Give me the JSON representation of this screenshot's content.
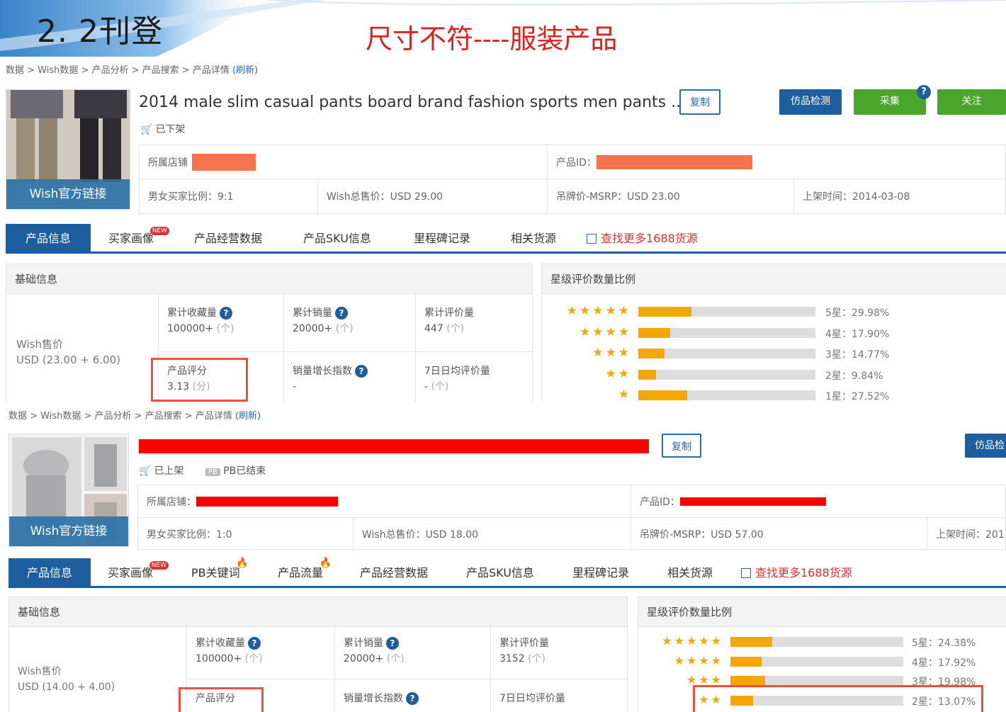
{
  "slide": {
    "number": "2. 2刊登",
    "title": "尺寸不符----服装产品"
  },
  "colors": {
    "accent": "#1d5f9e",
    "green": "#4aa62a",
    "star": "#f5a70a",
    "alert": "#e02020"
  },
  "panel_a": {
    "breadcrumb": "数据 > Wish数据 > 产品分析 > 产品搜索 > 产品详情",
    "refresh": "(刷新)",
    "thumb_link": "Wish官方链接",
    "title": "2014 male slim casual pants board brand fashion sports men pants ...",
    "copy_button": "复制",
    "buttons": {
      "detect": "仿品检测",
      "collect": "采集",
      "follow": "关注",
      "help": "?"
    },
    "status": "已下架",
    "info": {
      "store_label": "所属店铺",
      "product_id_label": "产品ID：",
      "gender_ratio": "男女买家比例：9:1",
      "total_price": "Wish总售价：USD 29.00",
      "msrp": "吊牌价-MSRP：USD 23.00",
      "listed": "上架时间：2014-03-08"
    },
    "tabs": [
      "产品信息",
      "买家画像",
      "产品经营数据",
      "产品SKU信息",
      "里程碑记录",
      "相关货源",
      "查找更多1688货源"
    ],
    "new_badge": "NEW",
    "basic": {
      "header": "基础信息",
      "wish_price_label": "Wish售价",
      "wish_price_value": "USD (23.00 + 6.00)",
      "fav_label": "累计收藏量",
      "fav_value": "100000+",
      "fav_unit": "(个)",
      "sales_label": "累计销量",
      "sales_value": "20000+",
      "sales_unit": "(个)",
      "reviews_label": "累计评价量",
      "reviews_value": "447",
      "reviews_unit": "(个)",
      "score_label": "产品评分",
      "score_value": "3.13",
      "score_unit": "(分)",
      "growth_label": "销量增长指数",
      "growth_value": "-",
      "avg7_label": "7日日均评价量",
      "avg7_value": "-",
      "avg7_unit": "(个)"
    },
    "ratings": {
      "header": "星级评价数量比例",
      "rows": [
        {
          "stars": 5,
          "pct": 29.98,
          "label": "5星：29.98%"
        },
        {
          "stars": 4,
          "pct": 17.9,
          "label": "4星：17.90%"
        },
        {
          "stars": 3,
          "pct": 14.77,
          "label": "3星：14.77%"
        },
        {
          "stars": 2,
          "pct": 9.84,
          "label": "2星：9.84%"
        },
        {
          "stars": 1,
          "pct": 27.52,
          "label": "1星：27.52%"
        }
      ]
    }
  },
  "panel_b": {
    "breadcrumb": "数据 > Wish数据 > 产品分析 > 产品搜索 > 产品详情",
    "refresh": "(刷新)",
    "thumb_link": "Wish官方链接",
    "copy_button": "复制",
    "detect_button": "仿品检",
    "status_listed": "已上架",
    "pb_badge": "PB",
    "status_pb": "PB已结束",
    "info": {
      "store_label": "所属店铺：",
      "product_id_label": "产品ID：",
      "gender_ratio": "男女买家比例：1:0",
      "total_price": "Wish总售价：USD 18.00",
      "msrp": "吊牌价-MSRP：USD 57.00",
      "listed": "上架时间：201"
    },
    "tabs": [
      "产品信息",
      "买家画像",
      "PB关键词",
      "产品流量",
      "产品经营数据",
      "产品SKU信息",
      "里程碑记录",
      "相关货源",
      "查找更多1688货源"
    ],
    "new_badge": "NEW",
    "basic": {
      "header": "基础信息",
      "wish_price_label": "Wish售价",
      "wish_price_value": "USD (14.00 + 4.00)",
      "fav_label": "累计收藏量",
      "fav_value": "100000+",
      "fav_unit": "(个)",
      "sales_label": "累计销量",
      "sales_value": "20000+",
      "sales_unit": "(个)",
      "reviews_label": "累计评价量",
      "reviews_value": "3152",
      "reviews_unit": "(个)",
      "score_label": "产品评分",
      "growth_label": "销量增长指数",
      "avg7_label": "7日日均评价量"
    },
    "ratings": {
      "header": "星级评价数量比例",
      "rows": [
        {
          "stars": 5,
          "pct": 24.38,
          "label": "5星：24.38%"
        },
        {
          "stars": 4,
          "pct": 17.92,
          "label": "4星：17.92%"
        },
        {
          "stars": 3,
          "pct": 19.98,
          "label": "3星：19.98%"
        },
        {
          "stars": 2,
          "pct": 13.07,
          "label": "2星：13.07%"
        }
      ]
    }
  }
}
